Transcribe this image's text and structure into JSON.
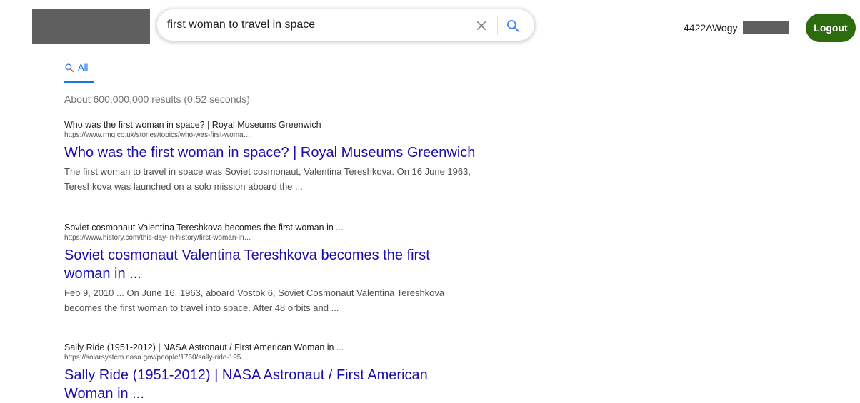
{
  "header": {
    "search": {
      "query": "first woman to travel in space"
    },
    "user": {
      "label": "4422AWogy"
    },
    "logout_label": "Logout"
  },
  "tabs": [
    {
      "label": "All"
    }
  ],
  "stats": "About 600,000,000 results (0.52 seconds)",
  "results": [
    {
      "site": "Who was the first woman in space? | Royal Museums Greenwich",
      "url": "https://www.rmg.co.uk/stories/topics/who-was-first-woma…",
      "title": "Who was the first woman in space? | Royal Museums Greenwich",
      "snippet": "The first woman to travel in space was Soviet cosmonaut, Valentina Tereshkova. On 16 June 1963, Tereshkova was launched on a solo mission aboard the ..."
    },
    {
      "site": "Soviet cosmonaut Valentina Tereshkova becomes the first woman in ...",
      "url": "https://www.history.com/this-day-in-history/first-woman-in…",
      "title": "Soviet cosmonaut Valentina Tereshkova becomes the first woman in ...",
      "snippet": "Feb 9, 2010 ... On June 16, 1963, aboard Vostok 6, Soviet Cosmonaut Valentina Tereshkova becomes the first woman to travel into space. After 48 orbits and ..."
    },
    {
      "site": "Sally Ride (1951-2012) | NASA Astronaut / First American Woman in ...",
      "url": "https://solarsystem.nasa.gov/people/1760/sally-ride-195…",
      "title": "Sally Ride (1951-2012) | NASA Astronaut / First American Woman in ...",
      "snippet": ""
    }
  ],
  "colors": {
    "accent": "#1a73e8",
    "link": "#1a0dab",
    "logout": "#2c6b0e",
    "redaction": "#5f5f5f"
  },
  "icons": {
    "clear": "close-icon",
    "search": "search-icon",
    "tab": "search-icon"
  }
}
